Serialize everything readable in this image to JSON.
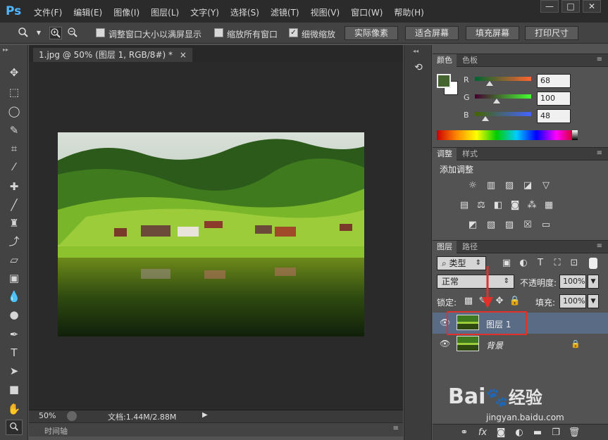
{
  "app": {
    "logo": "Ps"
  },
  "menu": [
    "文件(F)",
    "编辑(E)",
    "图像(I)",
    "图层(L)",
    "文字(Y)",
    "选择(S)",
    "滤镜(T)",
    "视图(V)",
    "窗口(W)",
    "帮助(H)"
  ],
  "window_controls": {
    "minimize": "—",
    "maximize": "□",
    "close": "✕"
  },
  "options": {
    "resize_windows_label": "调整窗口大小以满屏显示",
    "zoom_all_label": "缩放所有窗口",
    "scrubby_zoom_label": "细微缩放",
    "scrubby_zoom_checked": true,
    "actual_pixels": "实际像素",
    "fit_screen": "适合屏幕",
    "fill_screen": "填充屏幕",
    "print_size": "打印尺寸"
  },
  "document": {
    "tab_title": "1.jpg @ 50% (图层 1, RGB/8#) *",
    "tab_close": "×",
    "zoom": "50%",
    "doc_info": "文档:1.44M/2.88M",
    "timeline_label": "时间轴"
  },
  "color_panel": {
    "tabs": [
      "颜色",
      "色板"
    ],
    "r_label": "R",
    "g_label": "G",
    "b_label": "B",
    "r": "68",
    "g": "100",
    "b": "48",
    "foreground": "#446430",
    "background": "#ffffff"
  },
  "adjust_panel": {
    "tabs": [
      "调整",
      "样式"
    ],
    "title": "添加调整"
  },
  "layers_panel": {
    "tabs": [
      "图层",
      "路径"
    ],
    "filter_kind": "类型",
    "blend_mode": "正常",
    "opacity_label": "不透明度:",
    "opacity": "100%",
    "lock_label": "锁定:",
    "fill_label": "填充:",
    "fill": "100%",
    "layers": [
      {
        "name": "图层 1",
        "selected": true
      },
      {
        "name": "背景",
        "selected": false,
        "locked": true
      }
    ]
  },
  "watermark": {
    "brand": "Bai",
    "brand2": "经验",
    "url": "jingyan.baidu.com"
  },
  "colors": {
    "highlight_box": "#e0312b",
    "arrow": "#e0312b",
    "selected_layer": "#596b85"
  }
}
